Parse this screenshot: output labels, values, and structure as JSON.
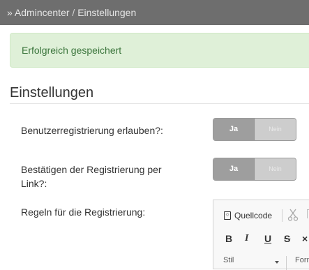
{
  "breadcrumb": {
    "prefix": "»",
    "items": [
      "Admincenter",
      "Einstellungen"
    ],
    "separator": "/"
  },
  "alert": {
    "message": "Erfolgreich gespeichert"
  },
  "page": {
    "title": "Einstellungen"
  },
  "settings": [
    {
      "label": "Benutzerregistrierung erlauben?:",
      "toggle": {
        "on_label": "Ja",
        "off_label": "Nein",
        "value": "Ja"
      }
    },
    {
      "label_line1": "Bestätigen der Registrierung per",
      "label_line2": "Link?:",
      "toggle": {
        "on_label": "Ja",
        "off_label": "Nein",
        "value": "Ja"
      }
    },
    {
      "label": "Regeln für die Registrierung:"
    }
  ],
  "editor": {
    "toolbar": {
      "source_label": "Quellcode",
      "bold": "B",
      "italic": "I",
      "underline": "U",
      "strike": "S",
      "remove_format": "×",
      "style_label": "Stil",
      "format_label": "Form"
    }
  },
  "colors": {
    "topbar_bg": "#6e6e6e",
    "alert_bg": "#dff0d8",
    "alert_text": "#3c763d",
    "toggle_on": "#9e9e9e",
    "toggle_off": "#cdcdcd"
  }
}
